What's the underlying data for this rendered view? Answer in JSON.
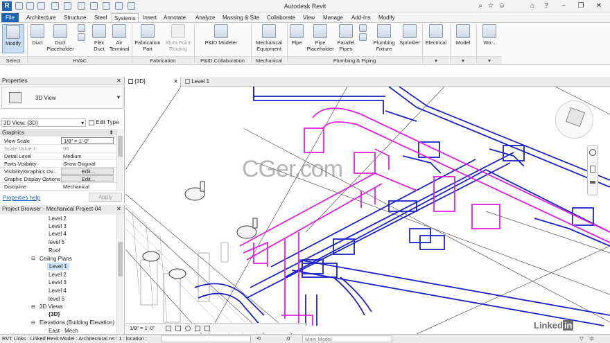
{
  "app": {
    "title": "Autodesk Revit",
    "file_tab": "File"
  },
  "ribbon_tabs": [
    "Architecture",
    "Structure",
    "Steel",
    "Systems",
    "Insert",
    "Annotate",
    "Analyze",
    "Massing & Site",
    "Collaborate",
    "View",
    "Manage",
    "Add-Ins",
    "Modify"
  ],
  "ribbon": {
    "modify": {
      "label": "Modify",
      "panel": "Select"
    },
    "hvac": {
      "duct": "Duct",
      "duct_placeholder": "Duct Placeholder",
      "flex_duct": "Flex Duct",
      "air_terminal": "Air Terminal",
      "panel": "HVAC"
    },
    "fabrication": {
      "part": "Fabrication Part",
      "routing": "Multi-Point Routing",
      "panel": "Fabrication"
    },
    "pid": {
      "modeler": "P&ID Modeler",
      "panel": "P&ID Collaboration"
    },
    "mechanical": {
      "equipment": "Mechanical Equipment",
      "panel": "Mechanical"
    },
    "plumbing": {
      "pipe": "Pipe",
      "pipe_placeholder": "Pipe Placeholder",
      "parallel_pipes": "Parallel Pipes",
      "fixture": "Plumbing Fixture",
      "sprinkler": "Sprinkler",
      "panel": "Plumbing & Piping"
    },
    "electrical": {
      "label": "Electrical"
    },
    "model": {
      "label": "Model"
    },
    "workplane": {
      "label": "Wo..."
    }
  },
  "properties": {
    "header": "Properties",
    "type_name": "3D View",
    "view_selector": "3D View: {3D}",
    "edit_type": "Edit Type",
    "group": "Graphics",
    "rows": [
      {
        "k": "View Scale",
        "v": "1/8\" = 1'-0\""
      },
      {
        "k": "Scale Value    1:",
        "v": "96"
      },
      {
        "k": "Detail Level",
        "v": "Medium"
      },
      {
        "k": "Parts Visibility",
        "v": "Show Original"
      },
      {
        "k": "Visibility/Graphics Ov...",
        "v": "Edit..."
      },
      {
        "k": "Graphic Display Options",
        "v": "Edit..."
      },
      {
        "k": "Discipline",
        "v": "Mechanical"
      }
    ],
    "help": "Properties help",
    "apply": "Apply"
  },
  "browser": {
    "header": "Project Browser - Mechanical Project-04",
    "items": [
      {
        "label": "Level 2",
        "indent": 3
      },
      {
        "label": "Level 3",
        "indent": 3
      },
      {
        "label": "Level 4",
        "indent": 3
      },
      {
        "label": "level 5",
        "indent": 3
      },
      {
        "label": "Roof",
        "indent": 3
      },
      {
        "label": "Ceiling Plans",
        "indent": 2
      },
      {
        "label": "Level 1",
        "indent": 3,
        "selected": true
      },
      {
        "label": "Level 2",
        "indent": 3
      },
      {
        "label": "Level 3",
        "indent": 3
      },
      {
        "label": "Level 4",
        "indent": 3
      },
      {
        "label": "level 5",
        "indent": 3
      },
      {
        "label": "3D Views",
        "indent": 2
      },
      {
        "label": "{3D}",
        "indent": 3,
        "bold": true
      },
      {
        "label": "Elevations (Building Elevation)",
        "indent": 2
      },
      {
        "label": "East - Mech",
        "indent": 3
      }
    ]
  },
  "view_tabs": {
    "tab1": "{3D}",
    "tab2": "Level 1"
  },
  "view_controls": {
    "scale": "1/8\" = 1'-0\""
  },
  "watermark": "CGer.com",
  "status": {
    "text": "RVT Links : Linked Revit Model : Architectural.rvt : 1 : location :",
    "model": "Main Model",
    "counter": ":0"
  },
  "colors": {
    "duct_blue": "#1a22c8",
    "duct_magenta": "#e020e0",
    "accent": "#1f64b4"
  }
}
